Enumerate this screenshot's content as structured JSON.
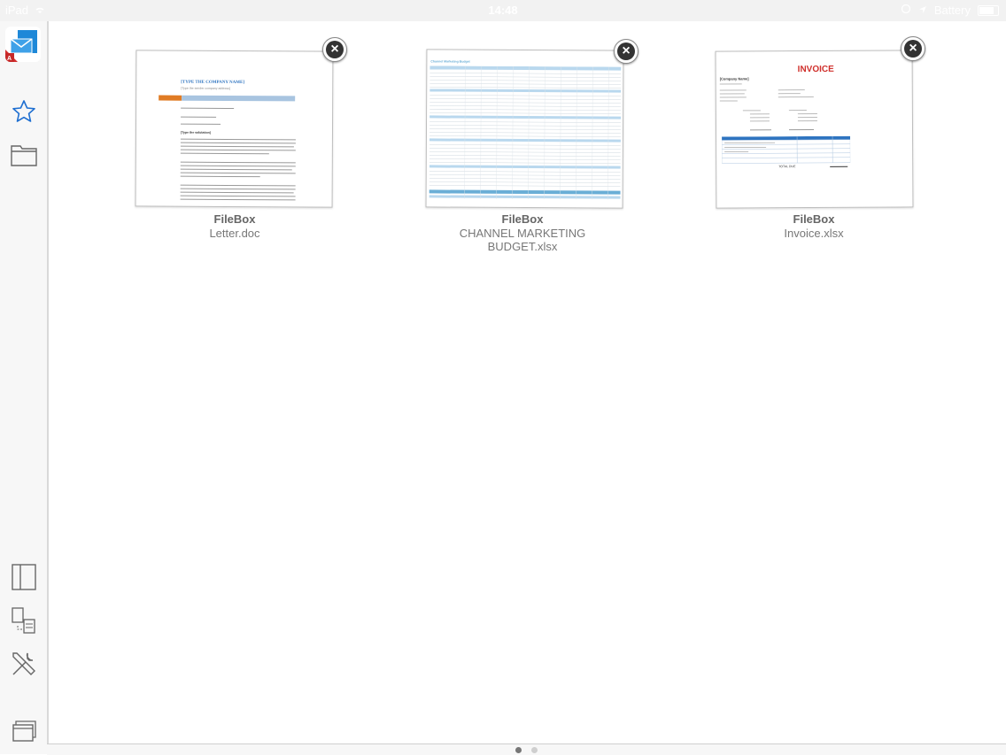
{
  "status_bar": {
    "carrier": "iPad",
    "time": "14:48",
    "battery": "Battery"
  },
  "sidebar": {
    "items": [
      {
        "name": "favorites",
        "icon": "star-icon"
      },
      {
        "name": "files",
        "icon": "folder-icon"
      },
      {
        "name": "split-view",
        "icon": "split-view-icon"
      },
      {
        "name": "transfer",
        "icon": "transfer-icon"
      },
      {
        "name": "settings",
        "icon": "tools-icon"
      },
      {
        "name": "windows",
        "icon": "windows-icon"
      }
    ]
  },
  "documents": [
    {
      "source": "FileBox",
      "name": "Letter.doc",
      "name_lines": [
        "Letter.doc"
      ]
    },
    {
      "source": "FileBox",
      "name": "CHANNEL MARKETING BUDGET.xlsx",
      "name_lines": [
        "CHANNEL MARKETING",
        "BUDGET.xlsx"
      ]
    },
    {
      "source": "FileBox",
      "name": "Invoice.xlsx",
      "name_lines": [
        "Invoice.xlsx"
      ]
    }
  ],
  "thumbnails": {
    "letter": {
      "heading": "[TYPE THE COMPANY NAME]",
      "subheading": "[Type the sender company address]",
      "salutation": "[Type the salutation]"
    },
    "budget": {
      "title": "Channel Marketing Budget"
    },
    "invoice": {
      "title": "INVOICE",
      "company": "[Company Name]",
      "total_label": "TOTAL DUE"
    }
  },
  "pagination": {
    "current": 1,
    "total": 2
  },
  "colors": {
    "accent_blue": "#2e74c0",
    "invoice_red": "#d0312d",
    "letter_orange": "#e07b24",
    "budget_blue": "#6aaed6"
  }
}
